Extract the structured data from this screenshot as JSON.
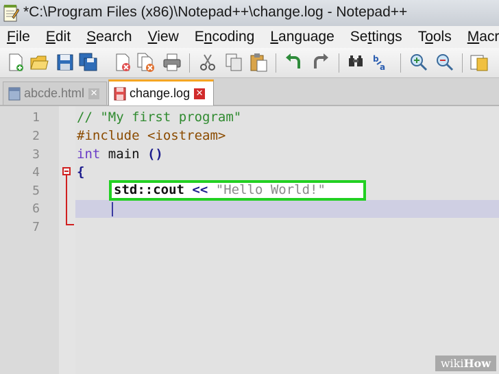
{
  "window": {
    "title": "*C:\\Program Files (x86)\\Notepad++\\change.log - Notepad++",
    "icon": "notepad-icon"
  },
  "menu": [
    {
      "label": "File",
      "u": "F",
      "rest": "ile"
    },
    {
      "label": "Edit",
      "u": "E",
      "rest": "dit"
    },
    {
      "label": "Search",
      "u": "S",
      "rest": "earch"
    },
    {
      "label": "View",
      "u": "V",
      "rest": "iew"
    },
    {
      "label": "Encoding",
      "u": "n",
      "pre": "E",
      "rest": "coding"
    },
    {
      "label": "Language",
      "u": "L",
      "rest": "anguage"
    },
    {
      "label": "Settings",
      "u": "t",
      "pre": "Se",
      "rest": "tings"
    },
    {
      "label": "Tools",
      "u": "o",
      "pre": "T",
      "rest": "ols"
    },
    {
      "label": "Macro",
      "u": "M",
      "rest": "acro"
    }
  ],
  "toolbar": {
    "icons": [
      "new-file-icon",
      "open-file-icon",
      "save-icon",
      "save-all-icon",
      "close-icon",
      "close-all-icon",
      "print-icon",
      "cut-icon",
      "copy-icon",
      "paste-icon",
      "undo-icon",
      "redo-icon",
      "find-icon",
      "replace-icon",
      "zoom-in-icon",
      "zoom-out-icon",
      "sync-scroll-icon"
    ]
  },
  "tabs": [
    {
      "label": "abcde.html",
      "active": false
    },
    {
      "label": "change.log",
      "active": true
    }
  ],
  "editor": {
    "line_numbers": [
      "1",
      "2",
      "3",
      "4",
      "5",
      "6",
      "7"
    ],
    "lines": [
      [
        {
          "t": "// \"My first program\"",
          "c": "c-comment"
        }
      ],
      [
        {
          "t": "#include <iostream>",
          "c": "c-pre"
        }
      ],
      [
        {
          "t": "int",
          "c": "c-kw"
        },
        {
          "t": " main ",
          "c": "c-plain"
        },
        {
          "t": "()",
          "c": "c-op"
        }
      ],
      [
        {
          "t": "{",
          "c": "c-op"
        }
      ],
      [],
      [],
      []
    ],
    "highlighted_line": {
      "std": "std::cout",
      "op": "<<",
      "str": "\"Hello World!\""
    },
    "fold_color": "#d02020",
    "highlight_color": "#22d022"
  },
  "watermark": {
    "wiki": "wiki",
    "how": "How"
  }
}
